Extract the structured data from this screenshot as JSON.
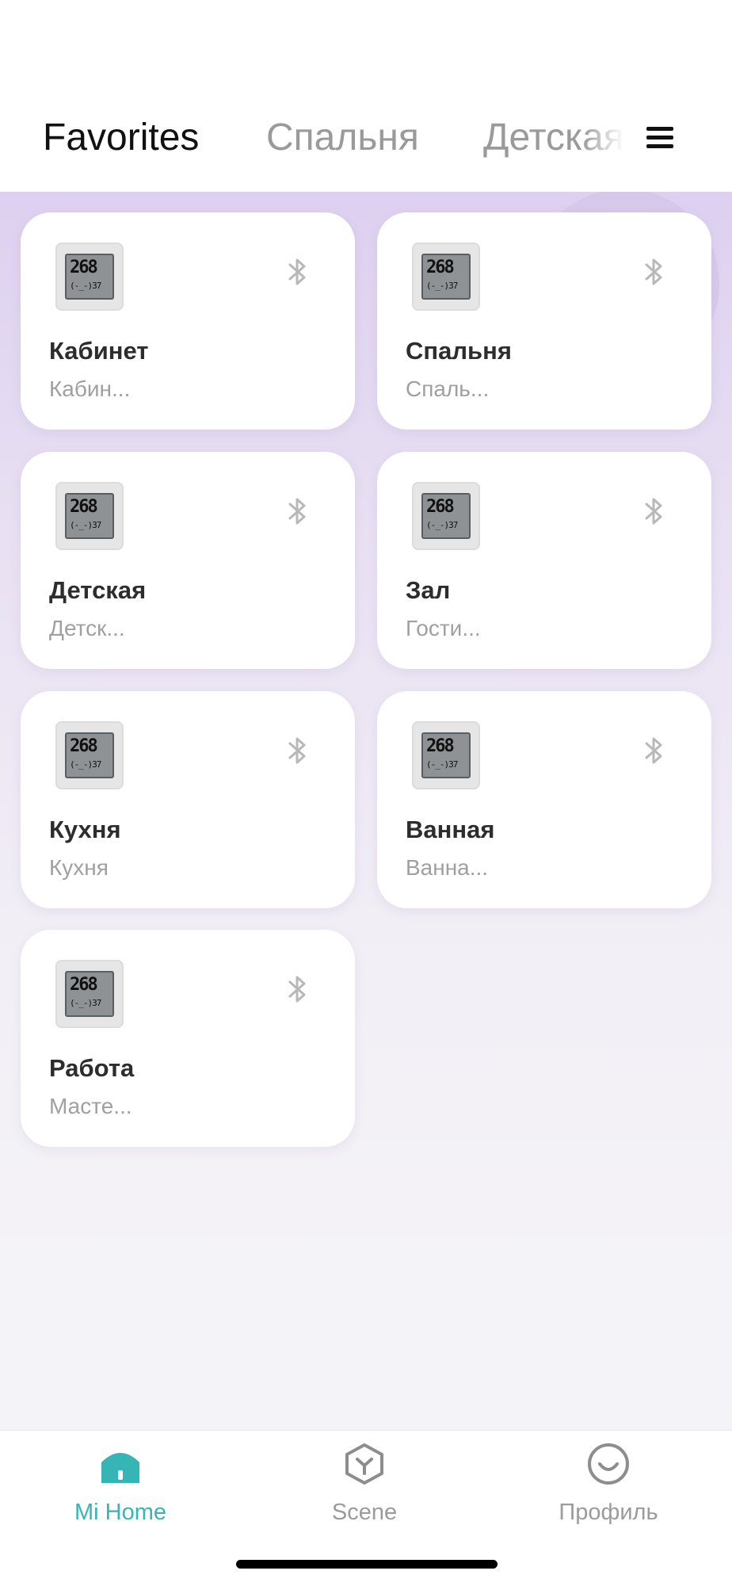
{
  "header": {
    "tabs": [
      {
        "label": "Favorites",
        "active": true
      },
      {
        "label": "Спальня",
        "active": false
      },
      {
        "label": "Детская",
        "active": false
      }
    ],
    "menu_icon": "hamburger-menu-icon"
  },
  "devices": [
    {
      "name": "Кабинет",
      "room": "Кабин...",
      "lcd_top": "268",
      "lcd_bottom": "(-_-)37",
      "status_icon": "bluetooth-icon"
    },
    {
      "name": "Спальня",
      "room": "Спаль...",
      "lcd_top": "268",
      "lcd_bottom": "(-_-)37",
      "status_icon": "bluetooth-icon"
    },
    {
      "name": "Детская",
      "room": "Детск...",
      "lcd_top": "268",
      "lcd_bottom": "(-_-)37",
      "status_icon": "bluetooth-icon"
    },
    {
      "name": "Зал",
      "room": "Гости...",
      "lcd_top": "268",
      "lcd_bottom": "(-_-)37",
      "status_icon": "bluetooth-icon"
    },
    {
      "name": "Кухня",
      "room": "Кухня",
      "lcd_top": "268",
      "lcd_bottom": "(-_-)37",
      "status_icon": "bluetooth-icon"
    },
    {
      "name": "Ванная",
      "room": "Ванна...",
      "lcd_top": "268",
      "lcd_bottom": "(-_-)37",
      "status_icon": "bluetooth-icon"
    },
    {
      "name": "Работа",
      "room": "Масте...",
      "lcd_top": "268",
      "lcd_bottom": "(-_-)37",
      "status_icon": "bluetooth-icon"
    }
  ],
  "bottom_nav": {
    "items": [
      {
        "label": "Mi Home",
        "icon": "home-icon",
        "active": true
      },
      {
        "label": "Scene",
        "icon": "scene-icon",
        "active": false
      },
      {
        "label": "Профиль",
        "icon": "profile-icon",
        "active": false
      }
    ]
  },
  "colors": {
    "accent": "#36b5b7",
    "background_top": "#ddd0f0",
    "card": "#ffffff",
    "inactive_text": "#9b9b9b"
  }
}
